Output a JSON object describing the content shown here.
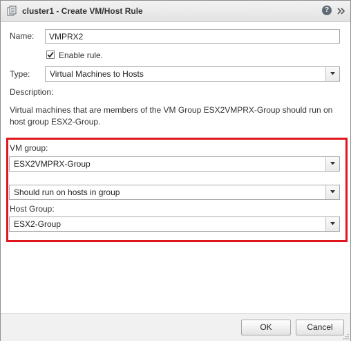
{
  "dialog": {
    "title": "cluster1 - Create VM/Host Rule",
    "icons": {
      "title": "cluster-rule-icon",
      "help": "help-icon",
      "expand": "double-chevron-right-icon"
    },
    "help_glyph": "?"
  },
  "form": {
    "name_label": "Name:",
    "name_value": "VMPRX2",
    "enable_label": "Enable rule.",
    "enable_checked": true,
    "type_label": "Type:",
    "type_value": "Virtual Machines to Hosts",
    "description_label": "Description:",
    "description_text": "Virtual machines that are members of the VM Group ESX2VMPRX-Group should run on host group ESX2-Group.",
    "vm_group_label": "VM group:",
    "vm_group_value": "ESX2VMPRX-Group",
    "rule_value": "Should run on hosts in group",
    "host_group_label": "Host Group:",
    "host_group_value": "ESX2-Group"
  },
  "colors": {
    "highlight": "#e0161d",
    "check": "#1d1d1d"
  },
  "footer": {
    "ok_label": "OK",
    "cancel_label": "Cancel"
  }
}
